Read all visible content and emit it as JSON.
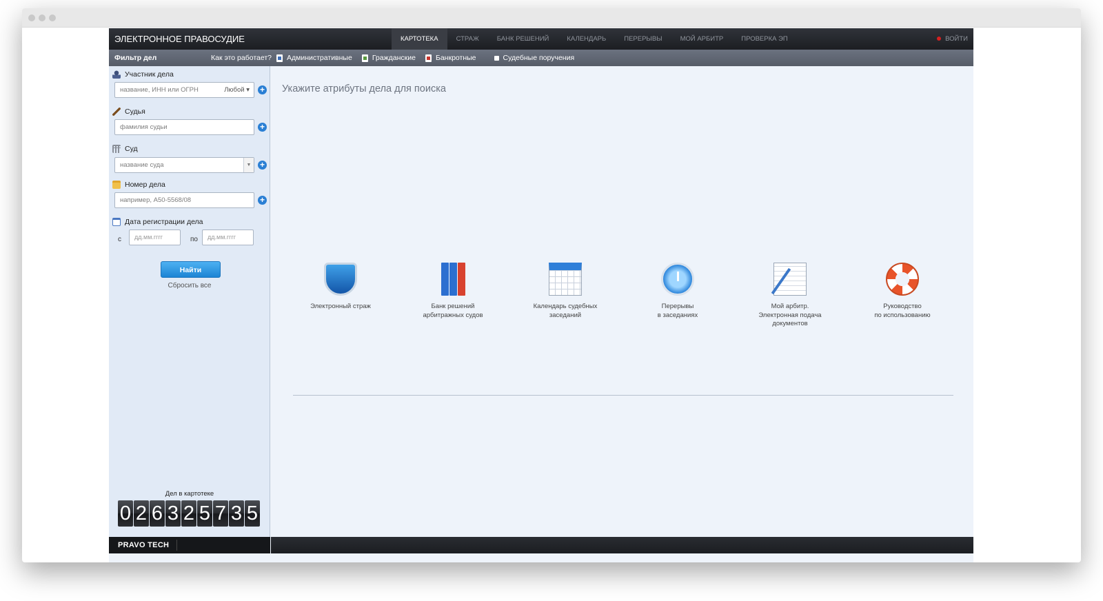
{
  "brand": "ЭЛЕКТРОННОЕ ПРАВОСУДИЕ",
  "nav": [
    {
      "label": "КАРТОТЕКА",
      "active": true
    },
    {
      "label": "СТРАЖ",
      "active": false
    },
    {
      "label": "БАНК РЕШЕНИЙ",
      "active": false
    },
    {
      "label": "КАЛЕНДАРЬ",
      "active": false
    },
    {
      "label": "ПЕРЕРЫВЫ",
      "active": false
    },
    {
      "label": "МОЙ АРБИТР",
      "active": false
    },
    {
      "label": "ПРОВЕРКА ЭП",
      "active": false
    }
  ],
  "login_label": "ВОЙТИ",
  "subnav": {
    "filter_title": "Фильтр дел",
    "howto": "Как это работает?",
    "categories": [
      "Административные",
      "Гражданские",
      "Банкротные",
      "Судебные поручения"
    ]
  },
  "sidebar": {
    "participant": {
      "label": "Участник дела",
      "placeholder": "название, ИНН или ОГРН",
      "scope": "Любой"
    },
    "judge": {
      "label": "Судья",
      "placeholder": "фамилия судьи"
    },
    "court": {
      "label": "Суд",
      "placeholder": "название суда"
    },
    "case_number": {
      "label": "Номер дела",
      "placeholder": "например, А50-5568/08"
    },
    "reg_date": {
      "label": "Дата регистрации дела",
      "from_label": "с",
      "to_label": "по",
      "from_placeholder": "дд.мм.гггг",
      "to_placeholder": "дд.мм.гггг"
    },
    "find_button": "Найти",
    "reset_link": "Сбросить все",
    "counter_label": "Дел в картотеке",
    "counter_digits": [
      "0",
      "2",
      "6",
      "3",
      "2",
      "5",
      "7",
      "3",
      "5"
    ]
  },
  "main": {
    "hint": "Укажите атрибуты дела для поиска",
    "tiles": [
      {
        "lines": [
          "Электронный страж"
        ],
        "icon": "shield-icon"
      },
      {
        "lines": [
          "Банк решений",
          "арбитражных судов"
        ],
        "icon": "binders-icon"
      },
      {
        "lines": [
          "Календарь судебных",
          "заседаний"
        ],
        "icon": "calendar-icon"
      },
      {
        "lines": [
          "Перерывы",
          "в заседаниях"
        ],
        "icon": "clock-icon"
      },
      {
        "lines": [
          "Мой арбитр.",
          "Электронная подача",
          "документов"
        ],
        "icon": "document-pen-icon"
      },
      {
        "lines": [
          "Руководство",
          "по использованию"
        ],
        "icon": "lifebuoy-icon"
      }
    ]
  },
  "footer": {
    "logo": "PRAVO TECH"
  },
  "colors": {
    "nav_bg": "#1c1e22",
    "accent": "#1d84d4",
    "login_dot": "#d42020"
  }
}
